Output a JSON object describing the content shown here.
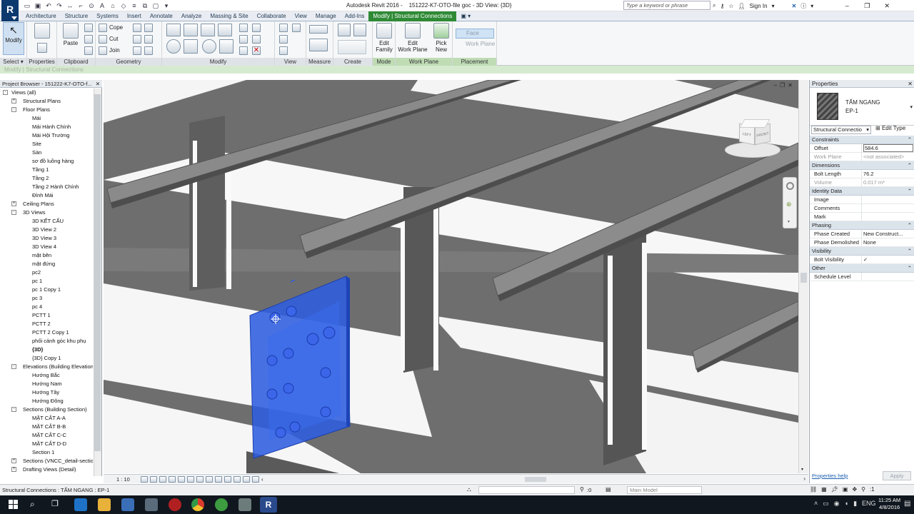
{
  "window": {
    "app_title": "Autodesk Revit 2016 -",
    "doc_title": "151222-K7-OTO-file goc - 3D View: {3D}",
    "search_placeholder": "Type a keyword or phrase",
    "sign_in": "Sign In"
  },
  "menu": {
    "tabs": [
      "Architecture",
      "Structure",
      "Systems",
      "Insert",
      "Annotate",
      "Analyze",
      "Massing & Site",
      "Collaborate",
      "View",
      "Manage",
      "Add-Ins",
      "Modify | Structural Connections"
    ]
  },
  "ribbon": {
    "modify": "Modify",
    "paste": "Paste",
    "cope": "Cope",
    "cut": "Cut",
    "join": "Join",
    "edit_family": "Edit Family",
    "edit_family_l1": "Edit",
    "edit_family_l2": "Family",
    "edit_work_plane_l1": "Edit",
    "edit_work_plane_l2": "Work Plane",
    "pick_new_l1": "Pick",
    "pick_new_l2": "New",
    "face": "Face",
    "work_plane_opt": "Work Plane",
    "panels": {
      "select": "Select",
      "properties": "Properties",
      "clipboard": "Clipboard",
      "geometry": "Geometry",
      "modify": "Modify",
      "view": "View",
      "measure": "Measure",
      "create": "Create",
      "mode": "Mode",
      "work_plane": "Work Plane",
      "placement": "Placement"
    }
  },
  "context_bar": "Modify | Structural Connections",
  "project_browser": {
    "title": "Project Browser - 151222-K7-OTO-f...",
    "tree": [
      {
        "label": "Views (all)",
        "level": 0,
        "exp": "-"
      },
      {
        "label": "Structural Plans",
        "level": 1,
        "exp": "+"
      },
      {
        "label": "Floor Plans",
        "level": 1,
        "exp": "-"
      },
      {
        "label": "Mái",
        "level": 2
      },
      {
        "label": "Mái Hành Chính",
        "level": 2
      },
      {
        "label": "Mái Hội Trường",
        "level": 2
      },
      {
        "label": "Site",
        "level": 2
      },
      {
        "label": "Sàn",
        "level": 2
      },
      {
        "label": "sơ đồ luồng hàng",
        "level": 2
      },
      {
        "label": "Tầng 1",
        "level": 2
      },
      {
        "label": "Tầng 2",
        "level": 2
      },
      {
        "label": "Tầng 2 Hành Chính",
        "level": 2
      },
      {
        "label": "Đỉnh Mái",
        "level": 2
      },
      {
        "label": "Ceiling Plans",
        "level": 1,
        "exp": "+"
      },
      {
        "label": "3D Views",
        "level": 1,
        "exp": "-"
      },
      {
        "label": "3D KẾT CẤU",
        "level": 2
      },
      {
        "label": "3D View 2",
        "level": 2
      },
      {
        "label": "3D View 3",
        "level": 2
      },
      {
        "label": "3D View 4",
        "level": 2
      },
      {
        "label": "mặt bên",
        "level": 2
      },
      {
        "label": "mặt đứng",
        "level": 2
      },
      {
        "label": "pc2",
        "level": 2
      },
      {
        "label": "pc 1",
        "level": 2
      },
      {
        "label": "pc 1 Copy 1",
        "level": 2
      },
      {
        "label": "pc 3",
        "level": 2
      },
      {
        "label": "pc 4",
        "level": 2
      },
      {
        "label": "PCTT 1",
        "level": 2
      },
      {
        "label": "PCTT 2",
        "level": 2
      },
      {
        "label": "PCTT 2 Copy 1",
        "level": 2
      },
      {
        "label": "phối cảnh góc khu phụ",
        "level": 2
      },
      {
        "label": "{3D}",
        "level": 2,
        "bold": true
      },
      {
        "label": "{3D} Copy 1",
        "level": 2
      },
      {
        "label": "Elevations (Building Elevation)",
        "level": 1,
        "exp": "-"
      },
      {
        "label": "Hướng Bắc",
        "level": 2
      },
      {
        "label": "Hướng Nam",
        "level": 2
      },
      {
        "label": "Hướng Tây",
        "level": 2
      },
      {
        "label": "Hướng Đông",
        "level": 2
      },
      {
        "label": "Sections (Building Section)",
        "level": 1,
        "exp": "-"
      },
      {
        "label": "MẶT CẮT A-A",
        "level": 2
      },
      {
        "label": "MẶT CẮT B-B",
        "level": 2
      },
      {
        "label": "MẶT CẮT C-C",
        "level": 2
      },
      {
        "label": "MẶT CẮT D-D",
        "level": 2
      },
      {
        "label": "Section 1",
        "level": 2
      },
      {
        "label": "Sections (VNCC_detail-section)",
        "level": 1,
        "exp": "+"
      },
      {
        "label": "Drafting Views (Detail)",
        "level": 1,
        "exp": "+"
      }
    ]
  },
  "view": {
    "scale": "1 : 10",
    "viewcube_left": "LEFT",
    "viewcube_front": "FRONT"
  },
  "properties": {
    "title": "Properties",
    "type_name": "TẤM NGANG",
    "type_sub": "EP-1",
    "category_selector": "Structural Connectio",
    "edit_type": "Edit Type",
    "groups": [
      {
        "name": "Constraints",
        "rows": [
          {
            "k": "Offset",
            "v": "584.6"
          },
          {
            "k": "Work Plane",
            "v": "<not associated>"
          }
        ]
      },
      {
        "name": "Dimensions",
        "rows": [
          {
            "k": "Bolt Length",
            "v": "76.2"
          },
          {
            "k": "Volume",
            "v": "0.017 m³"
          }
        ]
      },
      {
        "name": "Identity Data",
        "rows": [
          {
            "k": "Image",
            "v": ""
          },
          {
            "k": "Comments",
            "v": ""
          },
          {
            "k": "Mark",
            "v": ""
          }
        ]
      },
      {
        "name": "Phasing",
        "rows": [
          {
            "k": "Phase Created",
            "v": "New Construct..."
          },
          {
            "k": "Phase Demolished",
            "v": "None"
          }
        ]
      },
      {
        "name": "Visibility",
        "rows": [
          {
            "k": "Bolt Visibility",
            "v": "✓"
          }
        ]
      },
      {
        "name": "Other",
        "rows": [
          {
            "k": "Schedule Level",
            "v": ""
          }
        ]
      }
    ],
    "help_link": "Properties help",
    "apply": "Apply"
  },
  "status": {
    "text": "Structural Connections : TẤM NGANG : EP-1",
    "select_count": ":0",
    "model": "Main Model"
  },
  "taskbar": {
    "time": "11:25 AM",
    "date": "4/8/2016",
    "lang": "ENG"
  },
  "colors": {
    "selection_blue": "#2f5fe0",
    "context_green": "#2f8a36",
    "steel_gray": "#6b6b6b"
  }
}
